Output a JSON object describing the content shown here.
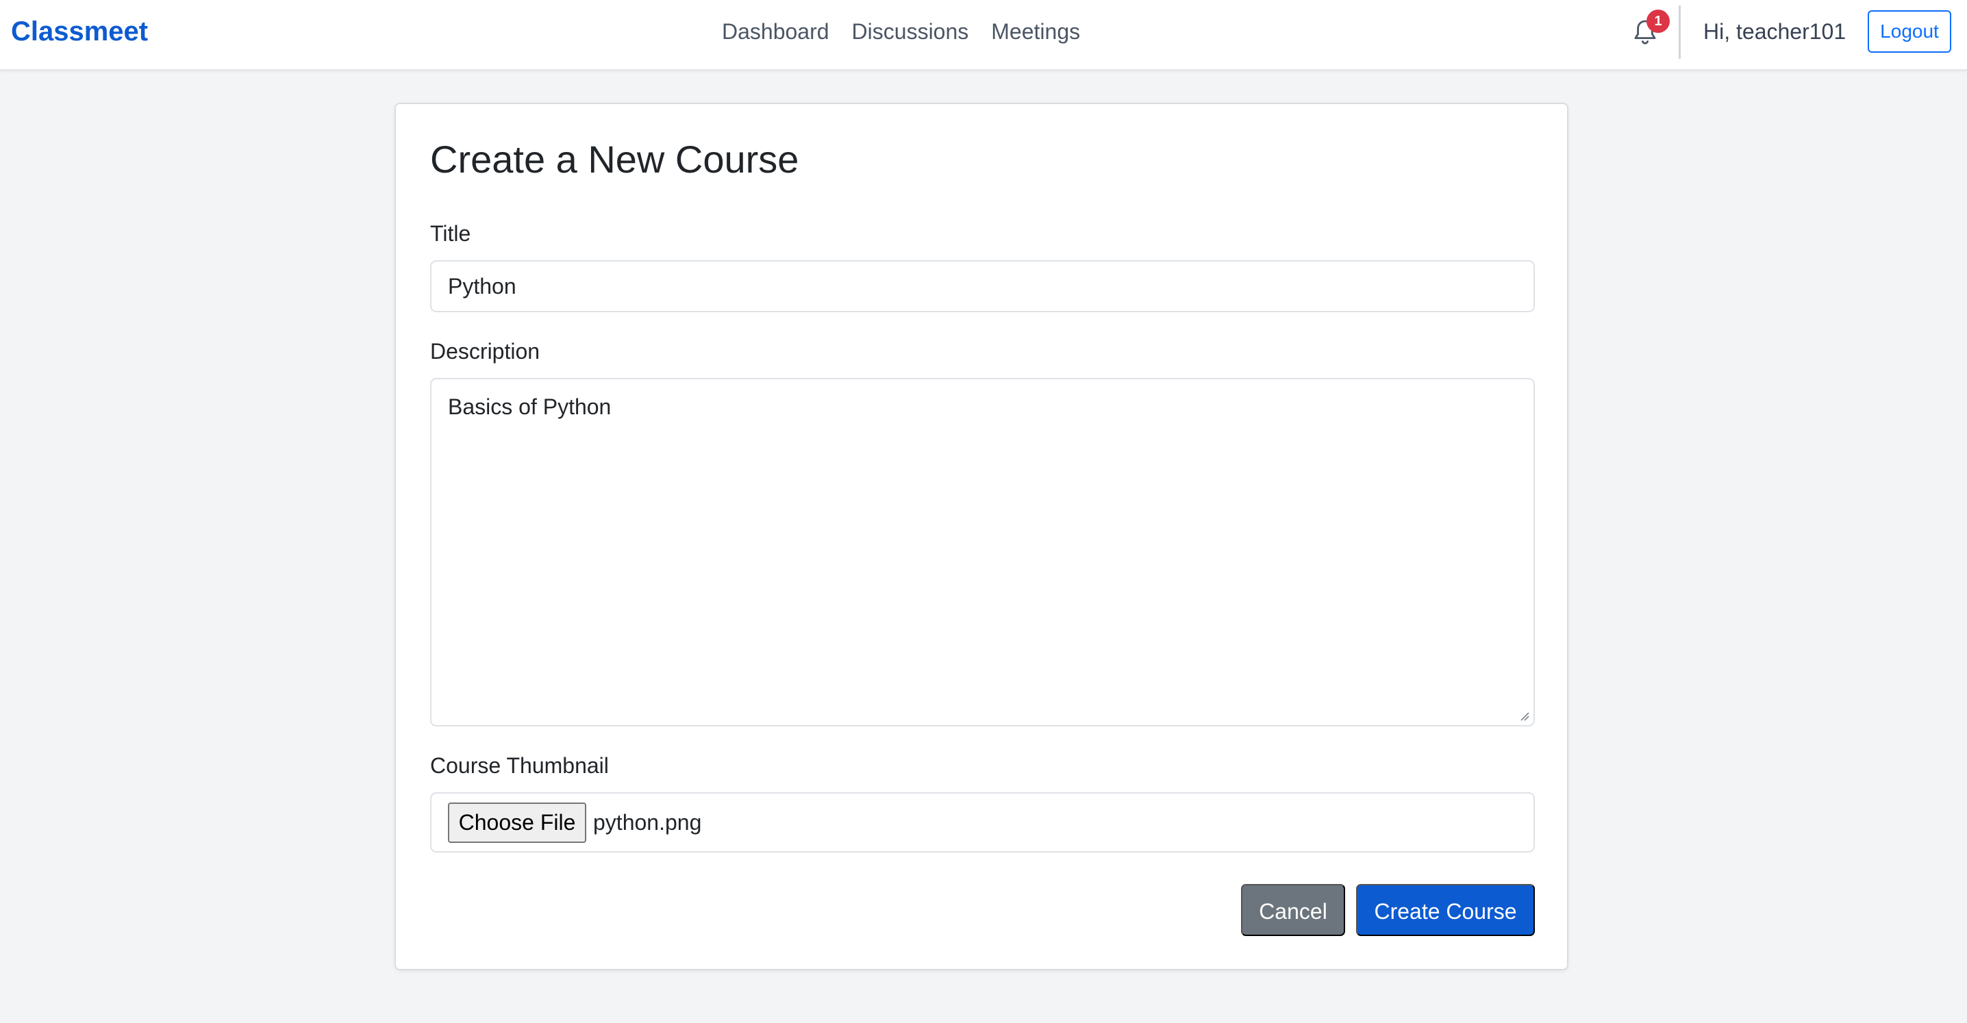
{
  "app": {
    "brand": "Classmeet"
  },
  "nav": {
    "links": [
      {
        "label": "Dashboard"
      },
      {
        "label": "Discussions"
      },
      {
        "label": "Meetings"
      }
    ],
    "notification_icon": "bell-icon",
    "notification_count": "1",
    "greeting": "Hi, teacher101",
    "logout_label": "Logout"
  },
  "form": {
    "heading": "Create a New Course",
    "title_label": "Title",
    "title_value": "Python",
    "description_label": "Description",
    "description_value": "Basics of Python",
    "thumbnail_label": "Course Thumbnail",
    "choose_file_label": "Choose File",
    "file_name": "python.png",
    "cancel_label": "Cancel",
    "submit_label": "Create Course"
  },
  "colors": {
    "brand": "#0d5bd1",
    "primary_button": "#0d5bd1",
    "secondary_button": "#6c757d",
    "badge": "#dc3545",
    "page_background": "#f3f4f6"
  }
}
